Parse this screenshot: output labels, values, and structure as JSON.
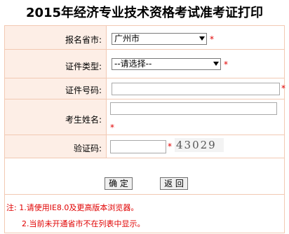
{
  "title": "2015年经济专业技术资格考试准考证打印",
  "form": {
    "province_label": "报名省市:",
    "province_value": "广州市",
    "id_type_label": "证件类型:",
    "id_type_value": "--请选择--",
    "id_number_label": "证件号码:",
    "name_label": "考生姓名:",
    "captcha_label": "验证码:",
    "captcha_text": "43029",
    "required_mark": "*"
  },
  "buttons": {
    "confirm": "确 定",
    "back": "返 回"
  },
  "notes": {
    "line1": "注: 1.请使用IE8.0及更高版本浏览器。",
    "line2": "2.当前未开通省市不在列表中显示。"
  },
  "colors": {
    "border": "#f2c9b3",
    "label_bg": "#fdeee6",
    "required": "#e00000"
  }
}
